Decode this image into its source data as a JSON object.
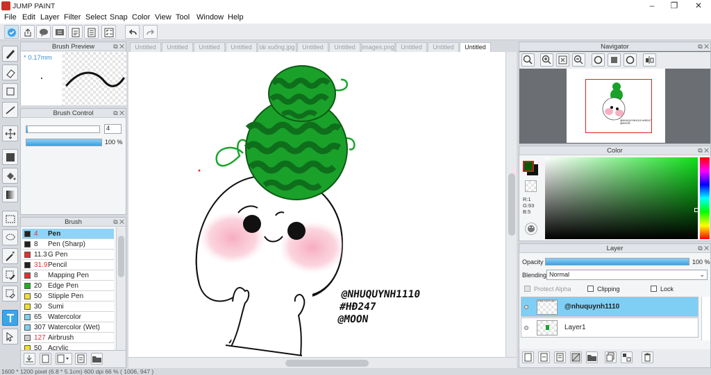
{
  "app": {
    "title": "JUMP PAINT",
    "window_controls": [
      "–",
      "❐",
      "✕"
    ]
  },
  "menu": [
    "File",
    "Edit",
    "Layer",
    "Filter",
    "Select",
    "Snap",
    "Color",
    "View",
    "Tool",
    "Window",
    "Help"
  ],
  "tabs": [
    "Untitled",
    "Untitled",
    "Untitled",
    "Untitled",
    "tải xuống.jpg",
    "Untitled",
    "Untitled",
    "images.png",
    "Untitled",
    "Untitled",
    "Untitled"
  ],
  "active_tab_index": 10,
  "brush_preview": {
    "title": "Brush Preview",
    "size": "0.17mm"
  },
  "brush_control": {
    "title": "Brush Control",
    "size_value": "4",
    "opacity_label": "100 %",
    "size_fraction": 0.02,
    "opacity_fraction": 1.0
  },
  "brush_panel": {
    "title": "Brush",
    "items": [
      {
        "size": "4",
        "name": "Pen",
        "color": "#222222",
        "size_red": true,
        "bold": true
      },
      {
        "size": "8",
        "name": "Pen (Sharp)",
        "color": "#222222",
        "size_red": false,
        "bold": false
      },
      {
        "size": "11.3",
        "name": "G Pen",
        "color": "#e03030",
        "size_red": false,
        "bold": false
      },
      {
        "size": "31.9",
        "name": "Pencil",
        "color": "#222222",
        "size_red": true,
        "bold": false
      },
      {
        "size": "8",
        "name": "Mapping Pen",
        "color": "#e03030",
        "size_red": false,
        "bold": false
      },
      {
        "size": "20",
        "name": "Edge Pen",
        "color": "#20b020",
        "size_red": false,
        "bold": false
      },
      {
        "size": "50",
        "name": "Stipple Pen",
        "color": "#f0e030",
        "size_red": false,
        "bold": false
      },
      {
        "size": "30",
        "name": "Sumi",
        "color": "#f0e030",
        "size_red": false,
        "bold": false
      },
      {
        "size": "65",
        "name": "Watercolor",
        "color": "#7fd0f0",
        "size_red": false,
        "bold": false
      },
      {
        "size": "307",
        "name": "Watercolor (Wet)",
        "color": "#7fd0f0",
        "size_red": false,
        "bold": false
      },
      {
        "size": "127",
        "name": "Airbrush",
        "color": "#cccccc",
        "size_red": true,
        "bold": false
      },
      {
        "size": "50",
        "name": "Acrylic",
        "color": "#f0e030",
        "size_red": false,
        "bold": false
      }
    ]
  },
  "artwork": {
    "text_lines": [
      "@NHUQUYNH1110",
      "#HĐ247",
      "@MOON"
    ]
  },
  "navigator": {
    "title": "Navigator",
    "thumb_text": "@NHUQUYNH1110 #HĐ247 @MOON"
  },
  "color_panel": {
    "title": "Color",
    "r": "R:1",
    "g": "G:93",
    "b": "B:5",
    "fg_color": "#015d05",
    "bg_color": "#111111"
  },
  "layer_panel": {
    "title": "Layer",
    "opacity_label": "Opacity",
    "opacity_value": "100 %",
    "opacity_fraction": 1.0,
    "blending_label": "Blending",
    "blending_value": "Normal",
    "protect_alpha": "Protect Alpha",
    "clipping": "Clipping",
    "lock": "Lock",
    "layers": [
      {
        "name": "@nhuquynh1110",
        "selected": true,
        "thumb_text": "@NHUQUYNH1110"
      },
      {
        "name": "Layer1",
        "selected": false,
        "thumb_text": ""
      }
    ]
  },
  "status": {
    "text": "1600 * 1200 pixel   (6.8 * 5.1cm)   600 dpi   66 %   ( 1006, 947 )"
  },
  "colors": {
    "accent": "#3ea4e8",
    "watermelon_dark": "#0f7a1e",
    "watermelon_light": "#19a52c",
    "blush": "#f8b6c8",
    "panel_bg": "#f4f5f6"
  }
}
